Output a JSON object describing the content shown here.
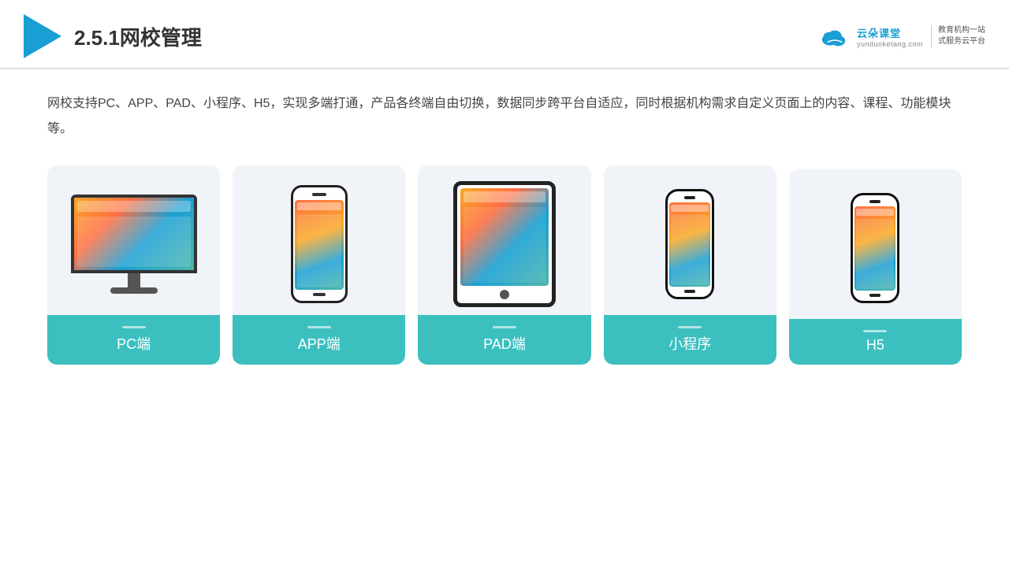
{
  "header": {
    "title": "2.5.1网校管理",
    "brand": {
      "name": "云朵课堂",
      "url": "yunduoketang.com",
      "slogan": "教育机构一站\n式服务云平台"
    }
  },
  "description": "网校支持PC、APP、PAD、小程序、H5，实现多端打通，产品各终端自由切换，数据同步跨平台自适应，同时根据机构需求自定义页面上的内容、课程、功能模块等。",
  "cards": [
    {
      "id": "pc",
      "label": "PC端"
    },
    {
      "id": "app",
      "label": "APP端"
    },
    {
      "id": "pad",
      "label": "PAD端"
    },
    {
      "id": "mini",
      "label": "小程序"
    },
    {
      "id": "h5",
      "label": "H5"
    }
  ]
}
